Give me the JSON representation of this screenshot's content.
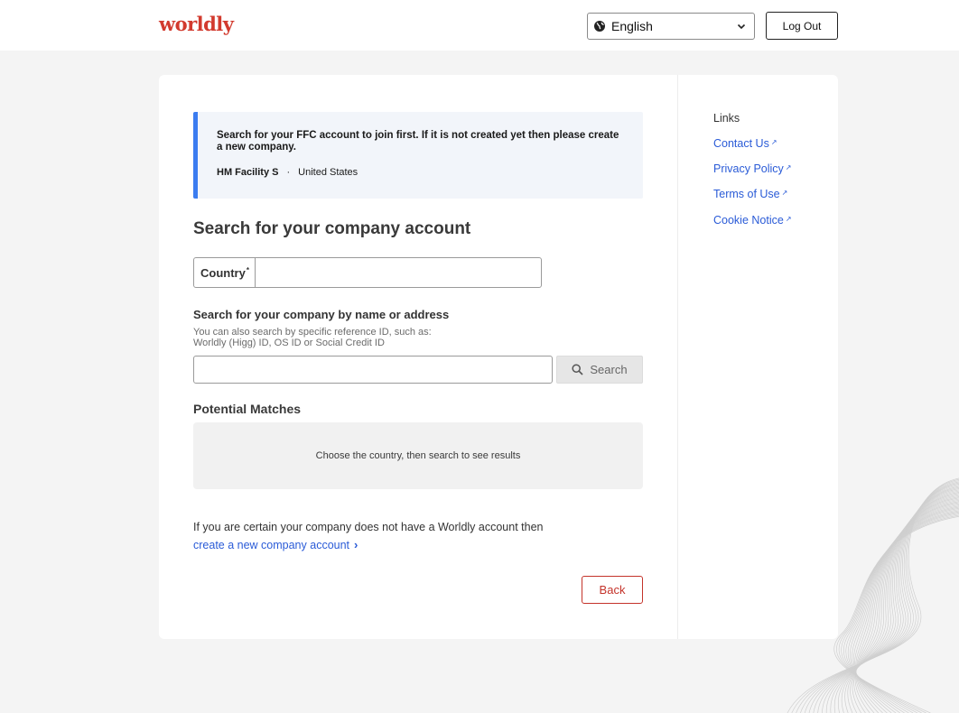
{
  "header": {
    "logo_text": "worldly",
    "language": {
      "selected": "English",
      "icon": "globe-icon"
    },
    "logout_label": "Log Out"
  },
  "notice": {
    "message": "Search for your FFC account to join first. If it is not created yet then please create a new company.",
    "facility": "HM Facility S",
    "separator": "·",
    "country": "United States"
  },
  "main": {
    "title": "Search for your company account",
    "country_label": "Country",
    "country_required_mark": "*",
    "country_value": "",
    "search_heading": "Search for your company by name or address",
    "search_hint_line1": "You can also search by specific reference ID, such as:",
    "search_hint_line2": "Worldly (Higg) ID, OS ID or Social Credit ID",
    "search_value": "",
    "search_button_label": "Search",
    "matches_heading": "Potential Matches",
    "results_placeholder": "Choose the country, then search to see results",
    "certain_text": "If you are certain your company does not have a Worldly account then",
    "create_link_label": "create a new company account",
    "create_link_chevron": "›",
    "back_label": "Back"
  },
  "links": {
    "title": "Links",
    "external_mark": "↗",
    "items": [
      {
        "label": "Contact Us"
      },
      {
        "label": "Privacy Policy"
      },
      {
        "label": "Terms of Use"
      },
      {
        "label": "Cookie Notice"
      }
    ]
  },
  "colors": {
    "brand": "#d23a2e",
    "link": "#2a5bd7",
    "notice_accent": "#3b7cf0",
    "back_button": "#c4332a",
    "page_background": "#f4f4f4"
  }
}
